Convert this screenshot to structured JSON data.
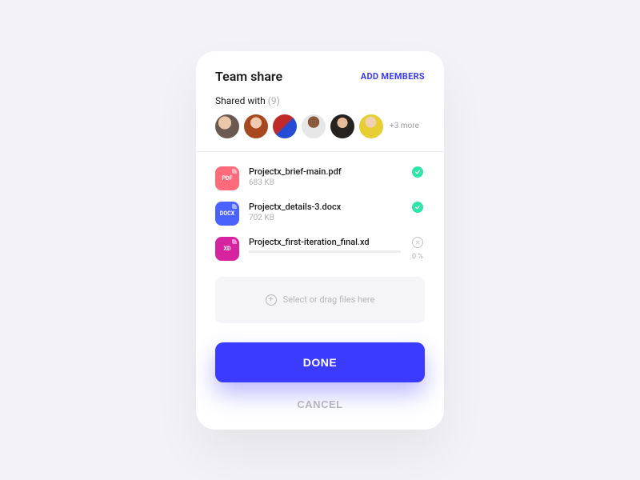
{
  "header": {
    "title": "Team share",
    "add_members_label": "ADD MEMBERS"
  },
  "shared": {
    "label": "Shared with",
    "count_text": "(9)",
    "more_text": "+3 more"
  },
  "files": [
    {
      "name": "Projectx_brief-main.pdf",
      "size": "683 KB",
      "type": "PDF",
      "status": "done"
    },
    {
      "name": "Projectx_details-3.docx",
      "size": "702 KB",
      "type": "DOCX",
      "status": "done"
    },
    {
      "name": "Projectx_first-iteration_final.xd",
      "size": "",
      "type": "XD",
      "status": "uploading",
      "progress_text": "0 %"
    }
  ],
  "dropzone": {
    "text": "Select or drag files here"
  },
  "actions": {
    "done_label": "DONE",
    "cancel_label": "CANCEL"
  },
  "colors": {
    "primary": "#3b3bff",
    "success": "#2ee5a8",
    "pdf": "#ff6b7a",
    "docx": "#4a63ff",
    "xd": "#d6239f"
  }
}
